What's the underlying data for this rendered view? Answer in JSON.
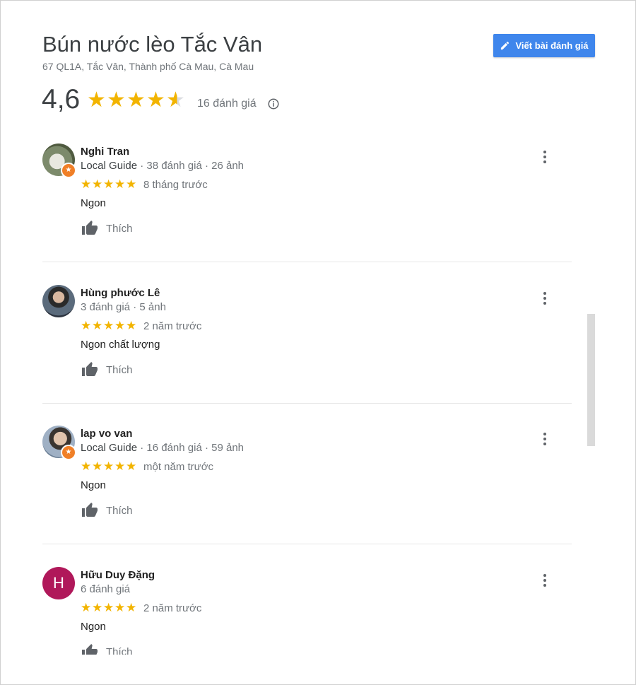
{
  "place": {
    "title": "Bún nước lèo Tắc Vân",
    "address": "67 QL1A, Tắc Vân, Thành phố Cà Mau, Cà Mau",
    "write_review_label": "Viết bài đánh giá",
    "rating": "4,6",
    "rating_value": 4.6,
    "review_count": "16 đánh giá",
    "info_icon": "info-icon"
  },
  "colors": {
    "accent": "#3f86ec",
    "star": "#f2b400",
    "local_guide_badge": "#f07f27",
    "avatar_letter_bg": "#b0185a"
  },
  "reviews": [
    {
      "name": "Nghi Tran",
      "guide": "Local Guide",
      "meta": " · 38 đánh giá · 26 ảnh",
      "stars": 5,
      "when": "8 tháng trước",
      "text": "Ngon",
      "like": "Thích",
      "local_guide": true
    },
    {
      "name": "Hùng phước Lê",
      "guide": "",
      "meta": "3 đánh giá · 5 ảnh",
      "stars": 5,
      "when": "2 năm trước",
      "text": "Ngon chất lượng",
      "like": "Thích",
      "local_guide": false
    },
    {
      "name": "lap vo van",
      "guide": "Local Guide",
      "meta": " · 16 đánh giá · 59 ảnh",
      "stars": 5,
      "when": "một năm trước",
      "text": "Ngon",
      "like": "Thích",
      "local_guide": true
    },
    {
      "name": "Hữu Duy Đặng",
      "guide": "",
      "meta": "6 đánh giá",
      "stars": 5,
      "when": "2 năm trước",
      "text": "Ngon",
      "like": "Thích",
      "local_guide": false,
      "avatar_letter": "H"
    }
  ]
}
